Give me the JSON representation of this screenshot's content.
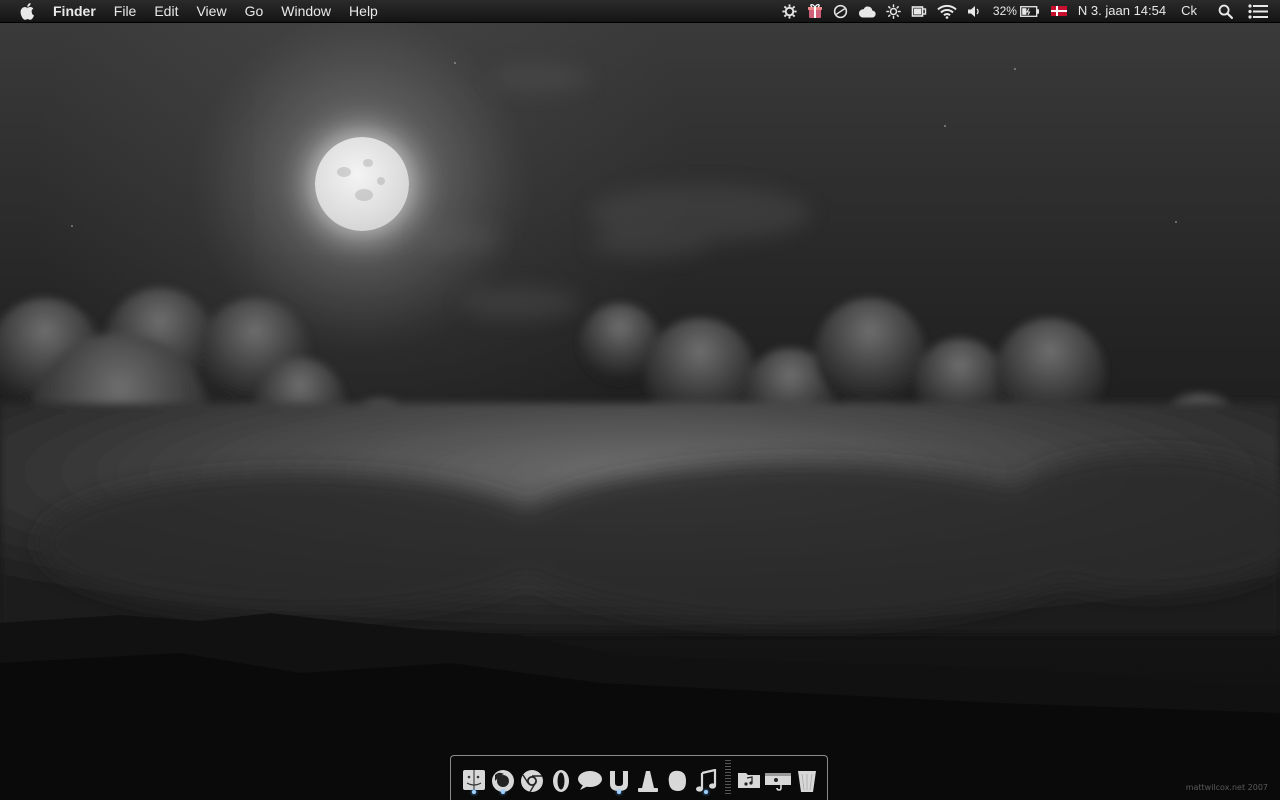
{
  "menubar": {
    "apple_icon": "apple-icon",
    "app_name": "Finder",
    "menus": [
      "File",
      "Edit",
      "View",
      "Go",
      "Window",
      "Help"
    ],
    "status": {
      "battery_percent": "32%",
      "input_flag": "Danish flag",
      "datetime": "N 3. jaan  14:54",
      "user": "Ck"
    }
  },
  "dock": {
    "apps": [
      {
        "name": "Finder",
        "icon": "finder-icon",
        "running": true
      },
      {
        "name": "Firefox",
        "icon": "firefox-icon",
        "running": true
      },
      {
        "name": "Chrome",
        "icon": "chrome-icon",
        "running": false
      },
      {
        "name": "Opera",
        "icon": "opera-icon",
        "running": false
      },
      {
        "name": "Adium",
        "icon": "chat-bubble-icon",
        "running": false
      },
      {
        "name": "uTorrent",
        "icon": "utorrent-icon",
        "running": true
      },
      {
        "name": "VLC",
        "icon": "vlc-cone-icon",
        "running": false
      },
      {
        "name": "Evernote",
        "icon": "evernote-icon",
        "running": false
      },
      {
        "name": "iTunes",
        "icon": "music-note-icon",
        "running": true
      }
    ],
    "stacks": [
      {
        "name": "Music folder",
        "icon": "music-folder-icon"
      },
      {
        "name": "Downloads",
        "icon": "downloads-icon"
      },
      {
        "name": "Trash",
        "icon": "trash-icon"
      }
    ]
  },
  "desktop": {
    "credit": "mattwilcox.net 2007"
  }
}
